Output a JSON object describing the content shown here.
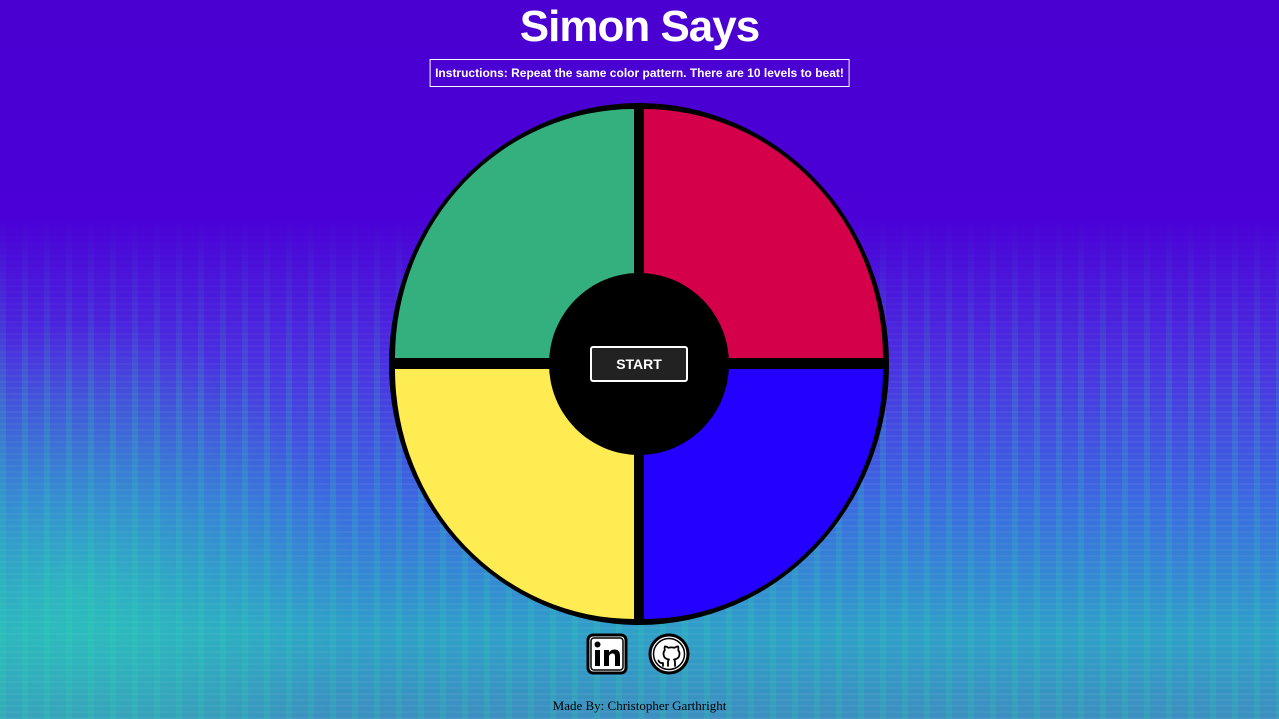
{
  "header": {
    "title": "Simon Says",
    "instructions": "Instructions: Repeat the same color pattern. There are 10 levels to beat!"
  },
  "game": {
    "start_label": "START",
    "pads": [
      {
        "name": "green",
        "color": "#33b07e"
      },
      {
        "name": "red",
        "color": "#d5004a"
      },
      {
        "name": "yellow",
        "color": "#ffec52"
      },
      {
        "name": "blue",
        "color": "#2400ff"
      }
    ]
  },
  "socials": [
    {
      "icon": "linkedin-icon",
      "label": "in"
    },
    {
      "icon": "github-icon"
    }
  ],
  "footer": {
    "credit": "Made By: Christopher Garthright"
  },
  "colors": {
    "background_top": "#4a00d0",
    "background_bottom": "#2fa0c8",
    "board_border": "#000000",
    "button_bg": "#222222"
  }
}
